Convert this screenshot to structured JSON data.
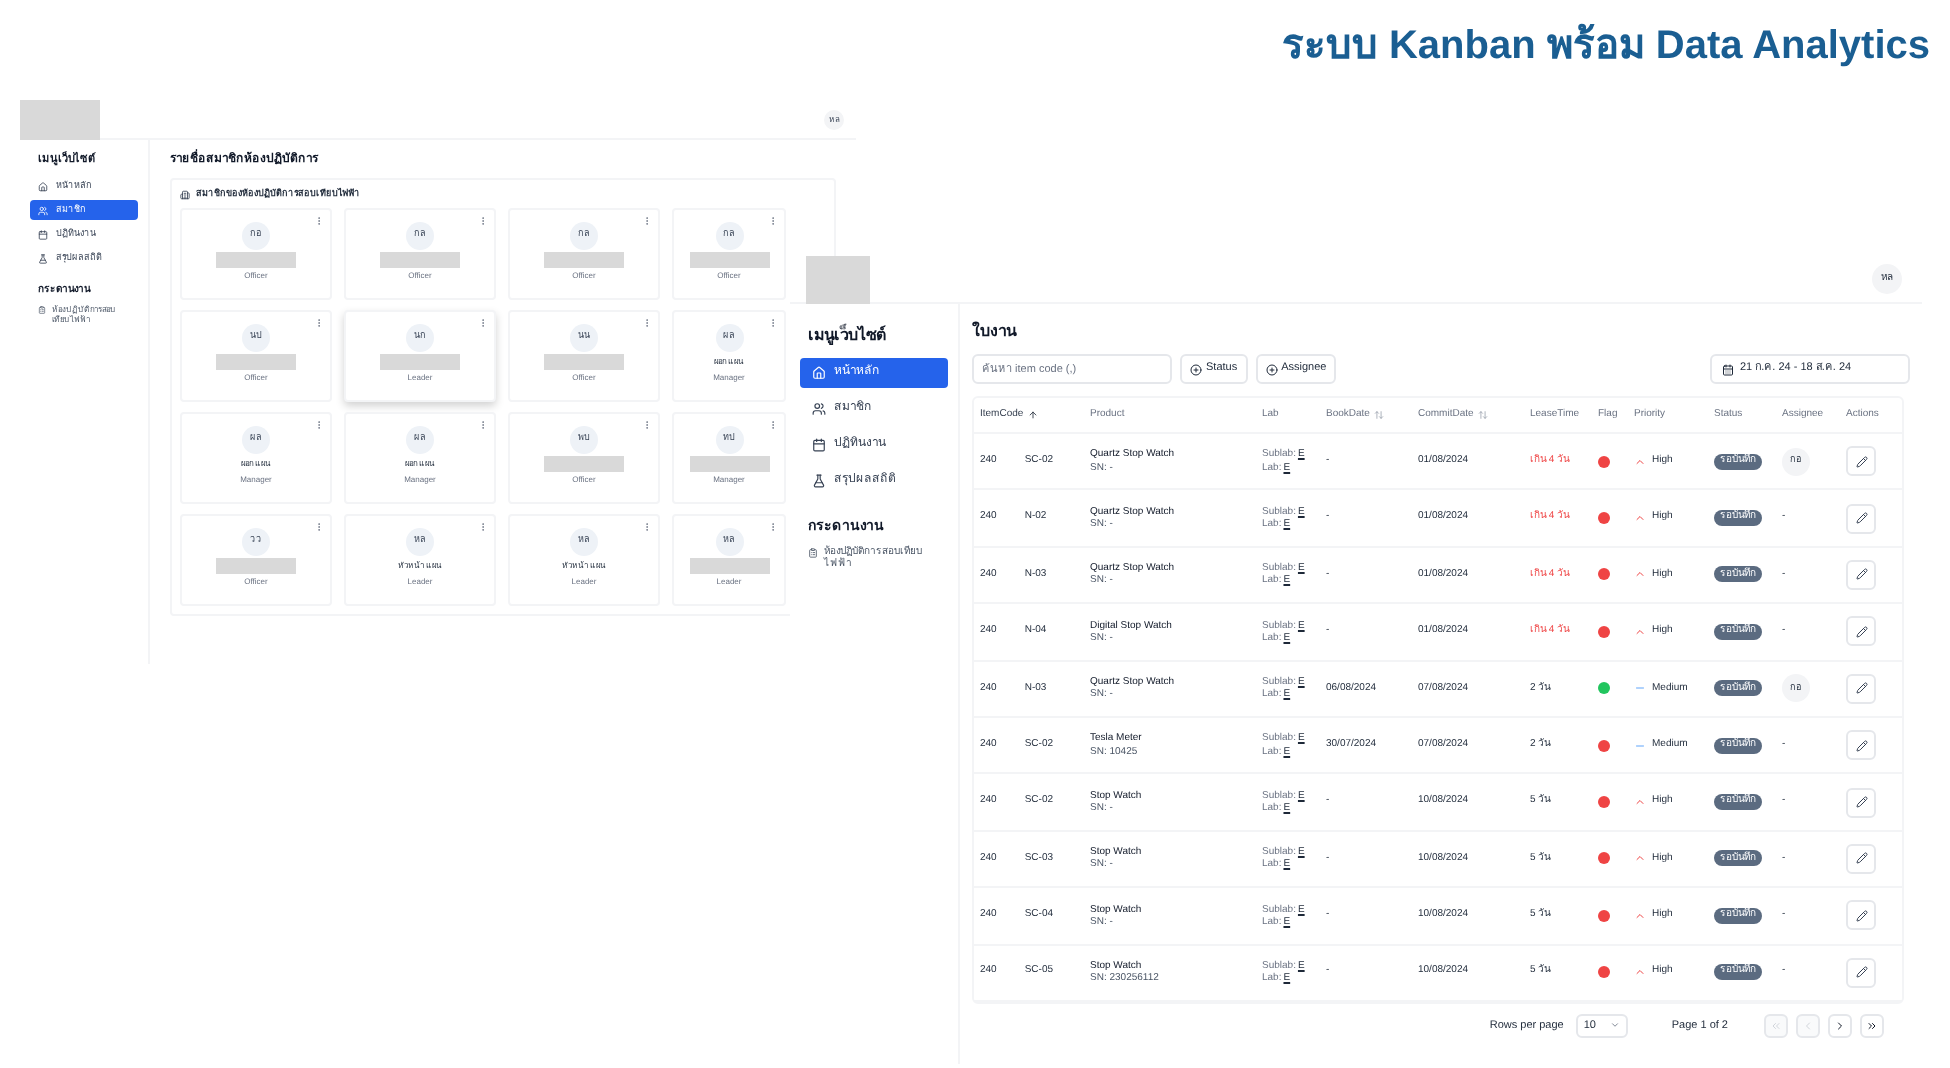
{
  "slide_title": "ระบบ Kanban พร้อม Data Analytics",
  "members_window": {
    "avatar": "หล",
    "sidebar": {
      "heading": "เมนูเว็บไซต์",
      "items": [
        {
          "label": "หน้าหลัก",
          "selected": false
        },
        {
          "label": "สมาชิก",
          "selected": true
        },
        {
          "label": "ปฏิทินงาน",
          "selected": false
        },
        {
          "label": "สรุปผลสถิติ",
          "selected": false
        }
      ],
      "board_heading": "กระดานงาน",
      "board_items": [
        {
          "label": "ห้องปฏิบัติการสอบเทียบไฟฟ้า",
          "selected": false
        }
      ]
    },
    "page_title": "รายชื่อสมาชิกห้องปฏิบัติการ",
    "panel_title": "สมาชิกของห้องปฏิบัติการสอบเทียบไฟฟ้า",
    "cards": [
      {
        "initials": "กอ",
        "redacted": true,
        "role": "Officer",
        "highlighted": false
      },
      {
        "initials": "กล",
        "redacted": true,
        "role": "Officer",
        "highlighted": false
      },
      {
        "initials": "กล",
        "redacted": true,
        "role": "Officer",
        "highlighted": false
      },
      {
        "initials": "กล",
        "redacted": true,
        "role": "Officer",
        "highlighted": false
      },
      {
        "initials": "นป",
        "redacted": true,
        "role": "Officer",
        "highlighted": false
      },
      {
        "initials": "นก",
        "redacted": true,
        "role": "Leader",
        "highlighted": true
      },
      {
        "initials": "นน",
        "redacted": true,
        "role": "Officer",
        "highlighted": false
      },
      {
        "initials": "ผล",
        "name": "ผอก แผน",
        "redacted": false,
        "role": "Manager",
        "highlighted": false
      },
      {
        "initials": "ผล",
        "name": "ผอก แผน",
        "redacted": false,
        "role": "Manager",
        "highlighted": false
      },
      {
        "initials": "ผล",
        "name": "ผอก แผน",
        "redacted": false,
        "role": "Manager",
        "highlighted": false
      },
      {
        "initials": "พบ",
        "redacted": true,
        "role": "Officer",
        "highlighted": false
      },
      {
        "initials": "ทป",
        "redacted": true,
        "role": "Manager",
        "highlighted": false
      },
      {
        "initials": "วว",
        "redacted": true,
        "role": "Officer",
        "highlighted": false
      },
      {
        "initials": "หล",
        "name": "หัวหน้า แผน",
        "redacted": false,
        "role": "Leader",
        "highlighted": false
      },
      {
        "initials": "หล",
        "name": "หัวหน้า แผน",
        "redacted": false,
        "role": "Leader",
        "highlighted": false
      },
      {
        "initials": "หล",
        "redacted": true,
        "role": "Leader",
        "highlighted": false
      }
    ]
  },
  "jobs_window": {
    "avatar": "หล",
    "sidebar": {
      "heading": "เมนูเว็บไซต์",
      "items": [
        {
          "label": "หน้าหลัก",
          "selected": true
        },
        {
          "label": "สมาชิก",
          "selected": false
        },
        {
          "label": "ปฏิทินงาน",
          "selected": false
        },
        {
          "label": "สรุปผลสถิติ",
          "selected": false
        }
      ],
      "board_heading": "กระดานงาน",
      "board_items": [
        {
          "label": "ห้องปฏิบัติการสอบเทียบไฟฟ้า",
          "selected": false
        }
      ]
    },
    "page_title": "ใบงาน",
    "search": {
      "placeholder": "ค้นหา item code (,)"
    },
    "filters": [
      "Status",
      "Assignee"
    ],
    "date_range": "21 ก.ค. 24 - 18 ส.ค. 24",
    "columns": [
      {
        "label": "ItemCode",
        "sortable": true,
        "ascending": true
      },
      {
        "label": "Product",
        "sortable": false,
        "ascending": false
      },
      {
        "label": "Lab",
        "sortable": false,
        "ascending": false
      },
      {
        "label": "BookDate",
        "sortable": true,
        "ascending": false
      },
      {
        "label": "CommitDate",
        "sortable": true,
        "ascending": false
      },
      {
        "label": "LeaseTime",
        "sortable": false,
        "ascending": false
      },
      {
        "label": "Flag",
        "sortable": false,
        "ascending": false
      },
      {
        "label": "Priority",
        "sortable": false,
        "ascending": false
      },
      {
        "label": "Status",
        "sortable": false,
        "ascending": false
      },
      {
        "label": "Assignee",
        "sortable": false,
        "ascending": false
      },
      {
        "label": "Actions",
        "sortable": false,
        "ascending": false
      }
    ],
    "rows": [
      {
        "code_start": "240",
        "code_end": "SC-02",
        "product": "Quartz Stop Watch",
        "sn": "SN: -",
        "sublab": "Sublab:",
        "sublab_value": "E",
        "lab": "Lab:",
        "lab_value": "E",
        "book_date": "-",
        "commit_date": "01/08/2024",
        "lease_time": "เกิน 4 วัน",
        "overdue": true,
        "color": "#ef4444",
        "priority": "High",
        "kind": "high",
        "status": "รอบันทึก",
        "assignee": "กอ"
      },
      {
        "code_start": "240",
        "code_end": "N-02",
        "product": "Quartz Stop Watch",
        "sn": "SN: -",
        "sublab": "Sublab:",
        "sublab_value": "E",
        "lab": "Lab:",
        "lab_value": "E",
        "book_date": "-",
        "commit_date": "01/08/2024",
        "lease_time": "เกิน 4 วัน",
        "overdue": true,
        "color": "#ef4444",
        "priority": "High",
        "kind": "high",
        "status": "รอบันทึก",
        "assignee": "-"
      },
      {
        "code_start": "240",
        "code_end": "N-03",
        "product": "Quartz Stop Watch",
        "sn": "SN: -",
        "sublab": "Sublab:",
        "sublab_value": "E",
        "lab": "Lab:",
        "lab_value": "E",
        "book_date": "-",
        "commit_date": "01/08/2024",
        "lease_time": "เกิน 4 วัน",
        "overdue": true,
        "color": "#ef4444",
        "priority": "High",
        "kind": "high",
        "status": "รอบันทึก",
        "assignee": "-"
      },
      {
        "code_start": "240",
        "code_end": "N-04",
        "product": "Digital Stop Watch",
        "sn": "SN: -",
        "sublab": "Sublab:",
        "sublab_value": "E",
        "lab": "Lab:",
        "lab_value": "E",
        "book_date": "-",
        "commit_date": "01/08/2024",
        "lease_time": "เกิน 4 วัน",
        "overdue": true,
        "color": "#ef4444",
        "priority": "High",
        "kind": "high",
        "status": "รอบันทึก",
        "assignee": "-"
      },
      {
        "code_start": "240",
        "code_end": "N-03",
        "product": "Quartz Stop Watch",
        "sn": "SN: -",
        "sublab": "Sublab:",
        "sublab_value": "E",
        "lab": "Lab:",
        "lab_value": "E",
        "book_date": "06/08/2024",
        "commit_date": "07/08/2024",
        "lease_time": "2 วัน",
        "overdue": false,
        "color": "#22c55e",
        "priority": "Medium",
        "kind": "medium",
        "status": "รอบันทึก",
        "assignee": "กอ"
      },
      {
        "code_start": "240",
        "code_end": "SC-02",
        "product": "Tesla Meter",
        "sn": "SN: 10425",
        "sublab": "Sublab:",
        "sublab_value": "E",
        "lab": "Lab:",
        "lab_value": "E",
        "book_date": "30/07/2024",
        "commit_date": "07/08/2024",
        "lease_time": "2 วัน",
        "overdue": false,
        "color": "#ef4444",
        "priority": "Medium",
        "kind": "medium",
        "status": "รอบันทึก",
        "assignee": "-"
      },
      {
        "code_start": "240",
        "code_end": "SC-02",
        "product": "Stop Watch",
        "sn": "SN: -",
        "sublab": "Sublab:",
        "sublab_value": "E",
        "lab": "Lab:",
        "lab_value": "E",
        "book_date": "-",
        "commit_date": "10/08/2024",
        "lease_time": "5 วัน",
        "overdue": false,
        "color": "#ef4444",
        "priority": "High",
        "kind": "high",
        "status": "รอบันทึก",
        "assignee": "-"
      },
      {
        "code_start": "240",
        "code_end": "SC-03",
        "product": "Stop Watch",
        "sn": "SN: -",
        "sublab": "Sublab:",
        "sublab_value": "E",
        "lab": "Lab:",
        "lab_value": "E",
        "book_date": "-",
        "commit_date": "10/08/2024",
        "lease_time": "5 วัน",
        "overdue": false,
        "color": "#ef4444",
        "priority": "High",
        "kind": "high",
        "status": "รอบันทึก",
        "assignee": "-"
      },
      {
        "code_start": "240",
        "code_end": "SC-04",
        "product": "Stop Watch",
        "sn": "SN: -",
        "sublab": "Sublab:",
        "sublab_value": "E",
        "lab": "Lab:",
        "lab_value": "E",
        "book_date": "-",
        "commit_date": "10/08/2024",
        "lease_time": "5 วัน",
        "overdue": false,
        "color": "#ef4444",
        "priority": "High",
        "kind": "high",
        "status": "รอบันทึก",
        "assignee": "-"
      },
      {
        "code_start": "240",
        "code_end": "SC-05",
        "product": "Stop Watch",
        "sn": "SN: 230256112",
        "sublab": "Sublab:",
        "sublab_value": "E",
        "lab": "Lab:",
        "lab_value": "E",
        "book_date": "-",
        "commit_date": "10/08/2024",
        "lease_time": "5 วัน",
        "overdue": false,
        "color": "#ef4444",
        "priority": "High",
        "kind": "high",
        "status": "รอบันทึก",
        "assignee": "-"
      }
    ],
    "footer": {
      "rows_label": "Rows per page",
      "rows_value": "10",
      "page": "Page 1 of 2",
      "nav": [
        {
          "kind": "first",
          "disabled": true
        },
        {
          "kind": "prev",
          "disabled": true
        },
        {
          "kind": "next",
          "disabled": false
        },
        {
          "kind": "last",
          "disabled": false
        }
      ]
    }
  }
}
